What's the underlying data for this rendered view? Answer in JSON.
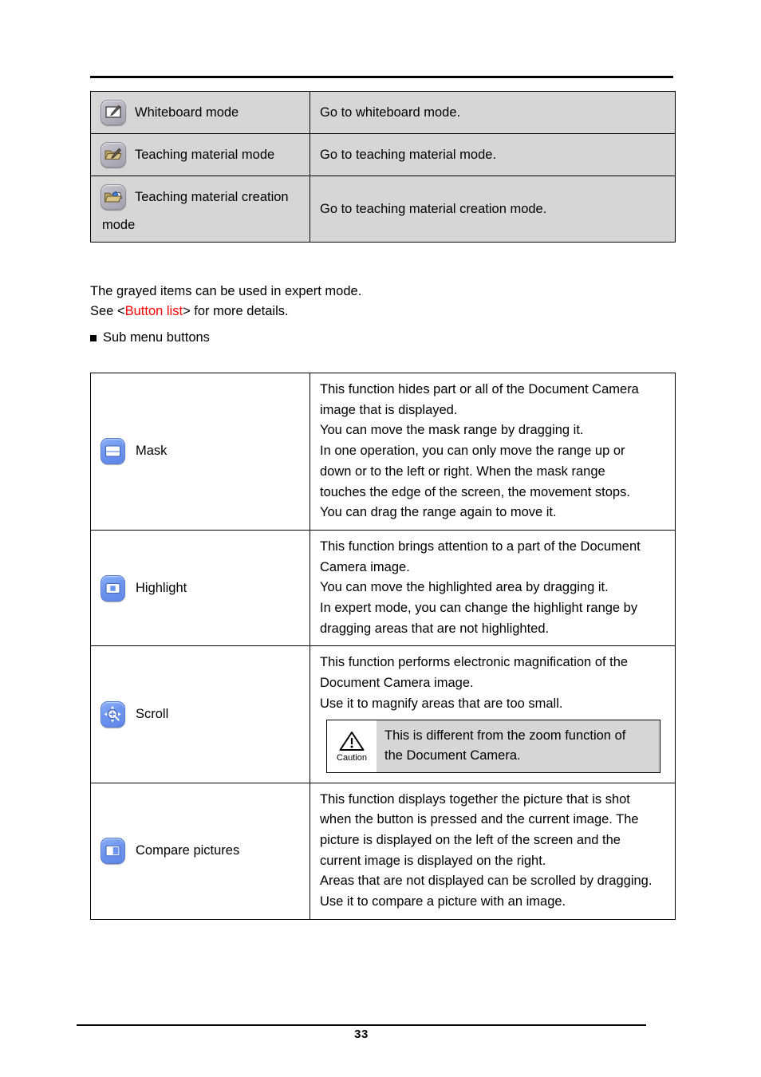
{
  "page": {
    "number": "33"
  },
  "mode_table": {
    "rows": [
      {
        "icon": "whiteboard-mode-icon",
        "label": "Whiteboard mode",
        "label_wrap": "",
        "description": "Go to whiteboard mode."
      },
      {
        "icon": "teaching-material-mode-icon",
        "label": "Teaching material mode",
        "label_wrap": "",
        "description": "Go to teaching material mode."
      },
      {
        "icon": "teaching-material-creation-mode-icon",
        "label": "Teaching material creation",
        "label_wrap": "mode",
        "description": "Go to teaching material creation mode."
      }
    ]
  },
  "notes": {
    "grayed_items": "The grayed items can be used in expert mode.",
    "see_prefix": "See <",
    "see_link": "Button list",
    "see_suffix": "> for more details.",
    "see_link_color": "#ff0000",
    "submenu_heading": "Sub menu buttons"
  },
  "submenu_table": {
    "rows": [
      {
        "icon": "mask-icon",
        "label": "Mask",
        "lines": [
          "This function hides part or all of the Document Camera",
          "image that is displayed.",
          "You can move the mask range by dragging it.",
          "In one operation, you can only move the range up or",
          "down or to the left or right. When the mask range",
          "touches the edge of the screen, the movement stops.",
          "You can drag the range again to move it."
        ]
      },
      {
        "icon": "highlight-icon",
        "label": "Highlight",
        "lines": [
          "This function brings attention to a part of the Document",
          "Camera image.",
          "You can move the highlighted area by dragging it.",
          "In expert mode, you can change the highlight range by",
          "dragging areas that are not highlighted."
        ]
      },
      {
        "icon": "scroll-icon",
        "label": "Scroll",
        "lines": [
          "This function performs electronic magnification of the",
          "Document Camera image.",
          "Use it to magnify areas that are too small."
        ],
        "caution": {
          "word": "Caution",
          "lines": [
            "This is different from the zoom function of",
            "the Document Camera."
          ]
        }
      },
      {
        "icon": "compare-pictures-icon",
        "label": "Compare pictures",
        "lines": [
          "This function displays together the picture that is shot",
          "when the button is pressed and the current image. The",
          "picture is displayed on the left of the screen and the",
          "current image is displayed on the right.",
          "Areas that are not displayed can be scrolled by dragging.",
          "Use it to compare a picture with an image."
        ]
      }
    ]
  }
}
